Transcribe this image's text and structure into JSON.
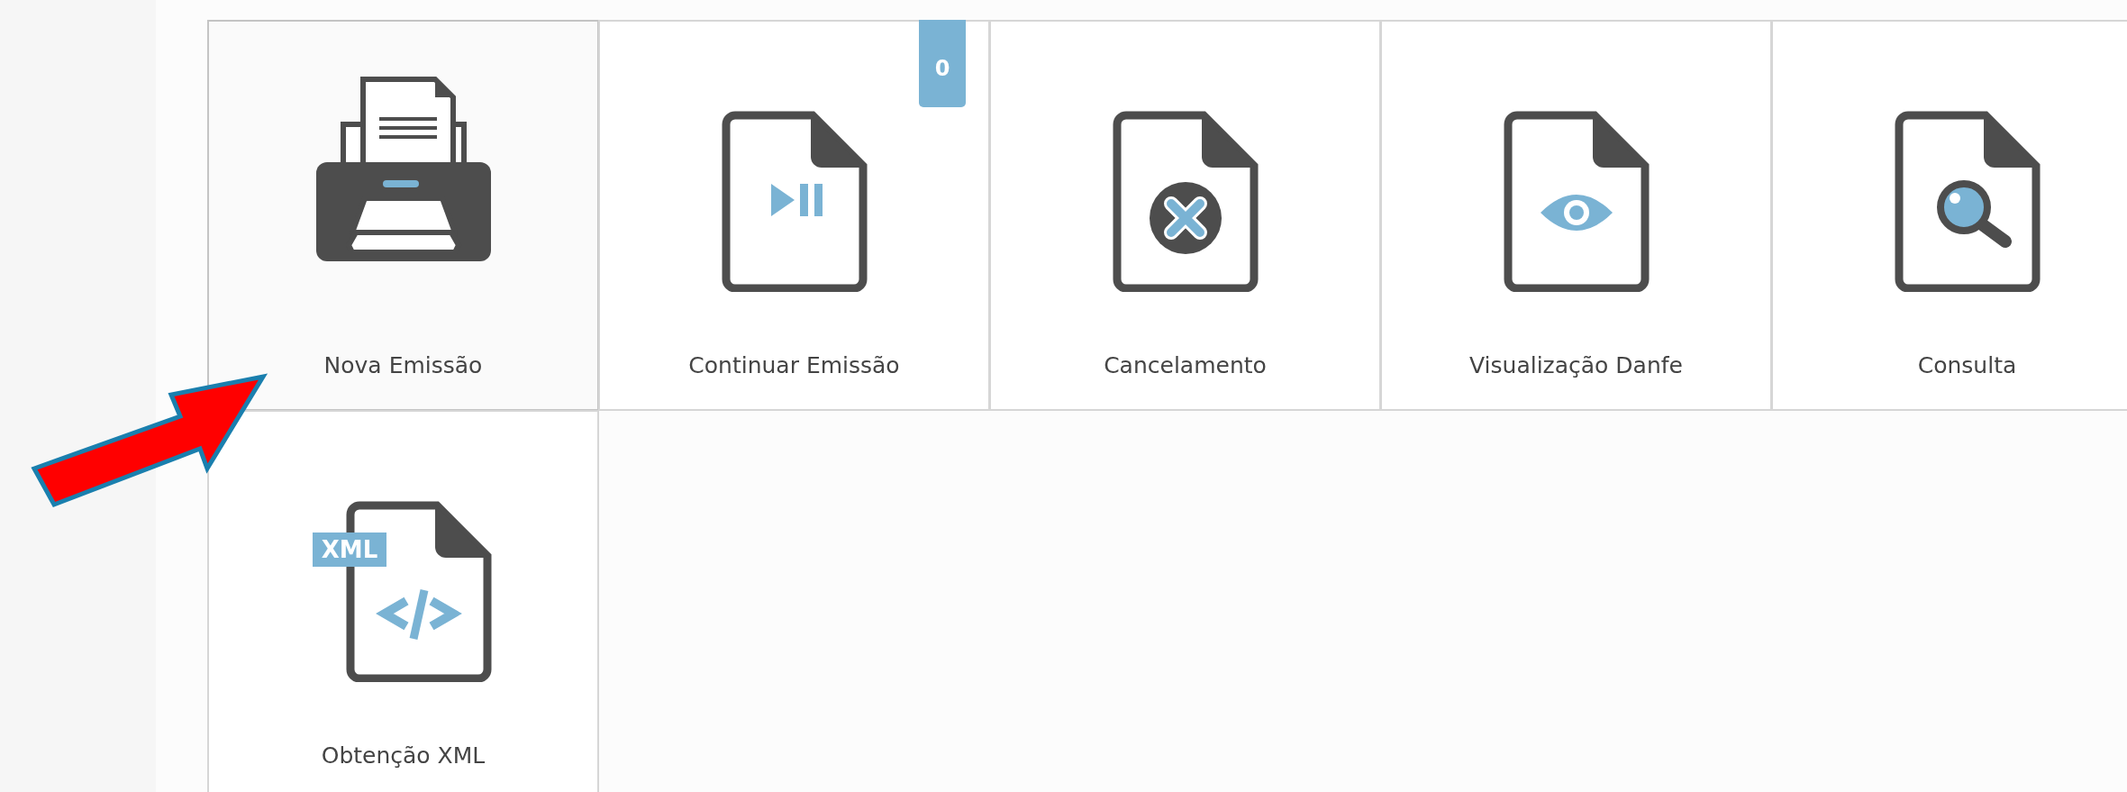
{
  "tiles": [
    {
      "label": "Nova Emissão",
      "kind": "printer",
      "selected": true
    },
    {
      "label": "Continuar Emissão",
      "kind": "resume",
      "selected": false,
      "badge": "0"
    },
    {
      "label": "Cancelamento",
      "kind": "cancel",
      "selected": false
    },
    {
      "label": "Visualização Danfe",
      "kind": "view",
      "selected": false
    },
    {
      "label": "Consulta",
      "kind": "query",
      "selected": false
    },
    {
      "label": "Obtenção XML",
      "kind": "download",
      "selected": false,
      "tag": "XML"
    }
  ]
}
